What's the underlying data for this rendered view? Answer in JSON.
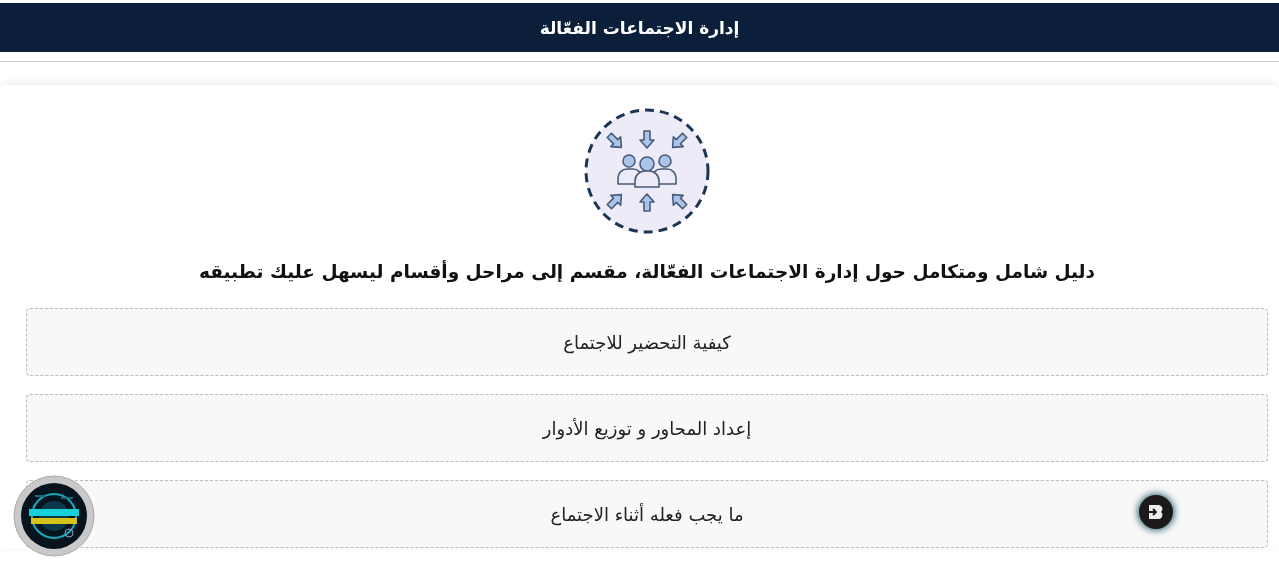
{
  "header": {
    "title": "إدارة الاجتماعات الفعّالة"
  },
  "intro": {
    "heading": "دليل شامل ومتكامل حول إدارة الاجتماعات الفعّالة، مقسم إلى مراحل وأقسام ليسهل عليك تطبيقه"
  },
  "sections": [
    {
      "title": "كيفية التحضير للاجتماع"
    },
    {
      "title": "إعداد المحاور و توزيع الأدوار"
    },
    {
      "title": "ما يجب فعله أثناء الاجتماع"
    }
  ]
}
